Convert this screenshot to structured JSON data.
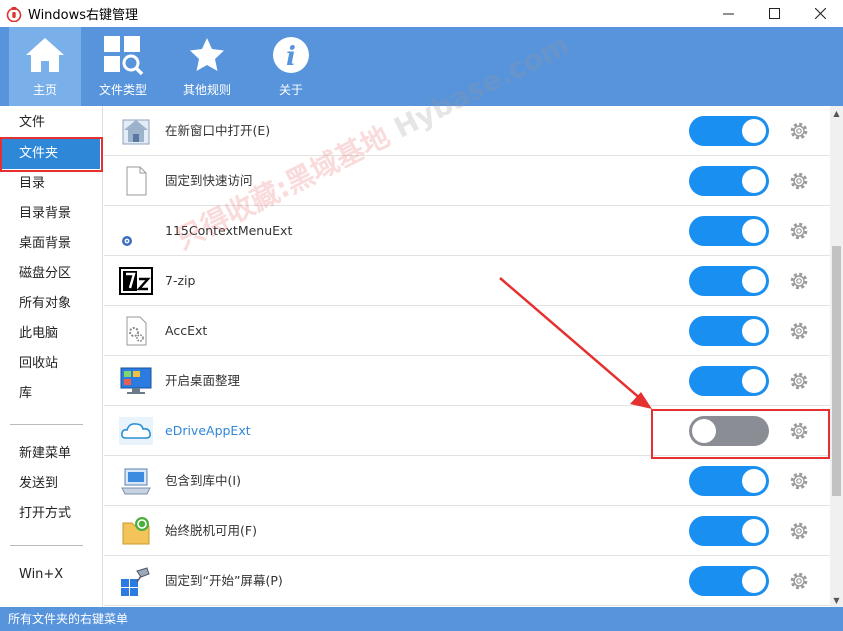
{
  "window": {
    "title": "Windows右键管理",
    "minimize_label": "—",
    "maximize_label": "☐",
    "close_label": "✕"
  },
  "toolbar": {
    "items": [
      {
        "label": "主页",
        "icon": "home-icon"
      },
      {
        "label": "文件类型",
        "icon": "grid-search-icon"
      },
      {
        "label": "其他规则",
        "icon": "star-icon"
      },
      {
        "label": "关于",
        "icon": "info-icon"
      }
    ]
  },
  "sidebar": {
    "items": [
      {
        "label": "文件"
      },
      {
        "label": "文件夹"
      },
      {
        "label": "目录"
      },
      {
        "label": "目录背景"
      },
      {
        "label": "桌面背景"
      },
      {
        "label": "磁盘分区"
      },
      {
        "label": "所有对象"
      },
      {
        "label": "此电脑"
      },
      {
        "label": "回收站"
      },
      {
        "label": "库"
      },
      {
        "label": "新建菜单"
      },
      {
        "label": "发送到"
      },
      {
        "label": "打开方式"
      },
      {
        "label": "Win+X"
      }
    ]
  },
  "list": {
    "rows": [
      {
        "label": "在新窗口中打开(E)",
        "icon": "house-window-icon",
        "enabled": true
      },
      {
        "label": "固定到快速访问",
        "icon": "blank-file-icon",
        "enabled": true
      },
      {
        "label": "115ContextMenuExt",
        "icon": "small-disc-icon",
        "enabled": true
      },
      {
        "label": "7-zip",
        "icon": "7zip-icon",
        "enabled": true
      },
      {
        "label": "AccExt",
        "icon": "gear-file-icon",
        "enabled": true
      },
      {
        "label": "开启桌面整理",
        "icon": "monitor-icon",
        "enabled": true
      },
      {
        "label": "eDriveAppExt",
        "icon": "cloud-icon",
        "enabled": false
      },
      {
        "label": "包含到库中(I)",
        "icon": "library-icon",
        "enabled": true
      },
      {
        "label": "始终脱机可用(F)",
        "icon": "sync-folder-icon",
        "enabled": true
      },
      {
        "label": "固定到“开始”屏幕(P)",
        "icon": "pin-start-icon",
        "enabled": true
      }
    ]
  },
  "statusbar": {
    "text": "所有文件夹的右键菜单"
  },
  "watermark": {
    "text_red": "只得收藏:黑域基地",
    "text_gray": " Hybase.com"
  },
  "colors": {
    "accent": "#5794dc",
    "toggle_on": "#1a8ff2",
    "toggle_off": "#8a8d93",
    "sidebar_active": "#2f87d8",
    "annotation_red": "#e53030"
  }
}
